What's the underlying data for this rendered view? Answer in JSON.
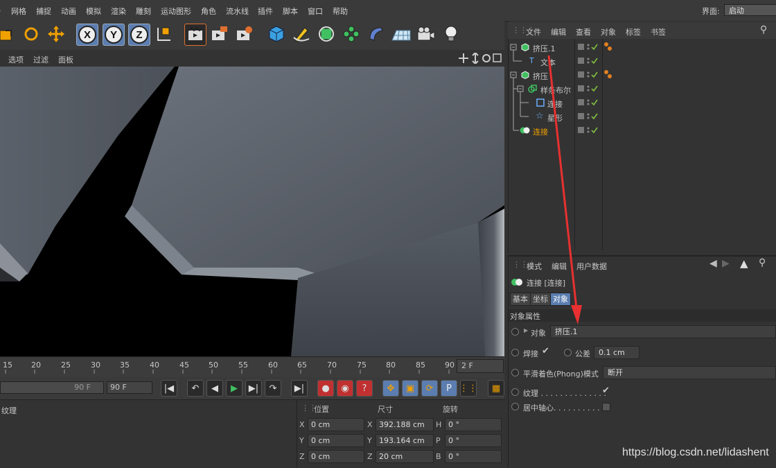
{
  "menu": {
    "items": [
      "网格",
      "捕捉",
      "动画",
      "模拟",
      "渲染",
      "雕刻",
      "运动图形",
      "角色",
      "流水线",
      "插件",
      "脚本",
      "窗口",
      "帮助"
    ],
    "layout_label": "界面:",
    "layout_value": "启动"
  },
  "viewport": {
    "menus": [
      "选项",
      "过滤",
      "面板"
    ]
  },
  "timeline": {
    "ticks": [
      "15",
      "20",
      "25",
      "30",
      "35",
      "40",
      "45",
      "50",
      "55",
      "60",
      "65",
      "70",
      "75",
      "80",
      "85",
      "90"
    ],
    "current_frame": "2 F",
    "end_frame_a": "90 F",
    "end_frame_b": "90 F"
  },
  "material_panel": {
    "label": "纹理"
  },
  "coord_panel": {
    "headers": [
      "位置",
      "尺寸",
      "旋转"
    ],
    "rows": [
      {
        "a": "X",
        "pos": "0 cm",
        "b": "X",
        "size": "392.188 cm",
        "c": "H",
        "rot": "0 °"
      },
      {
        "a": "Y",
        "pos": "0 cm",
        "b": "Y",
        "size": "193.164 cm",
        "c": "P",
        "rot": "0 °"
      },
      {
        "a": "Z",
        "pos": "0 cm",
        "b": "Z",
        "size": "20 cm",
        "c": "B",
        "rot": "0 °"
      }
    ]
  },
  "object_manager": {
    "menus": [
      "文件",
      "编辑",
      "查看",
      "对象",
      "标签",
      "书签"
    ],
    "objects": [
      {
        "name": "挤压.1",
        "highlight": false
      },
      {
        "name": "文本",
        "highlight": false
      },
      {
        "name": "挤压",
        "highlight": false
      },
      {
        "name": "样条布尔",
        "highlight": false
      },
      {
        "name": "连接",
        "highlight": false
      },
      {
        "name": "星形",
        "highlight": false
      },
      {
        "name": "连接",
        "highlight": true
      }
    ]
  },
  "attribute_manager": {
    "menus": [
      "模式",
      "编辑",
      "用户数据"
    ],
    "title": "连接 [连接]",
    "tabs": [
      "基本",
      "坐标",
      "对象"
    ],
    "section": "对象属性",
    "object_label": "对象",
    "object_value": "挤压.1",
    "weld_label": "焊接",
    "tolerance_label": "公差",
    "tolerance_value": "0.1 cm",
    "phong_label": "平滑着色(Phong)模式",
    "phong_value": "断开",
    "texture_label": "纹理 . . . . . . . . . . . . . .",
    "center_label": "居中轴心. . . . . . . . . . . ."
  },
  "watermark": "https://blog.csdn.net/lidashent",
  "colors": {
    "highlight": "#f0a000",
    "accent_blue": "#5b7db0",
    "arrow_red": "#e83030",
    "check_green": "#7fc040"
  }
}
